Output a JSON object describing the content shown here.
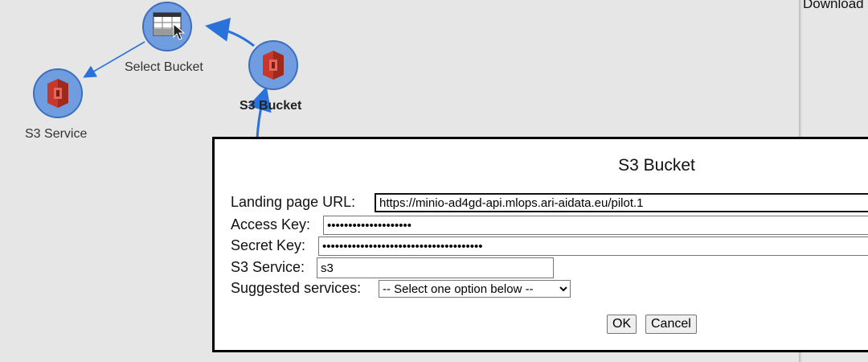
{
  "graph": {
    "nodes": [
      {
        "id": "select-bucket",
        "label": "Select Bucket",
        "icon": "table-pointer-icon"
      },
      {
        "id": "s3-service",
        "label": "S3 Service",
        "icon": "s3-icon"
      },
      {
        "id": "s3-bucket",
        "label": "S3 Bucket",
        "icon": "s3-icon",
        "selected": true
      }
    ]
  },
  "right_pane": {
    "title": "Download"
  },
  "dialog": {
    "title": "S3 Bucket",
    "landing_url_label": "Landing page URL:",
    "landing_url_value": "https://minio-ad4gd-api.mlops.ari-aidata.eu/pilot.1",
    "access_key_label": "Access Key:",
    "access_key_value": "••••••••••••••••••••",
    "secret_key_label": "Secret Key:",
    "secret_key_value": "••••••••••••••••••••••••••••••••••••••",
    "s3_service_label": "S3 Service:",
    "s3_service_value": "s3",
    "suggested_label": "Suggested services:",
    "suggested_selected": "-- Select one option below --",
    "ok_label": "OK",
    "cancel_label": "Cancel"
  },
  "colors": {
    "node_fill": "#6f9de0",
    "node_border": "#3d6fc0",
    "s3_red": "#c7382a",
    "edge": "#2a72d9"
  }
}
